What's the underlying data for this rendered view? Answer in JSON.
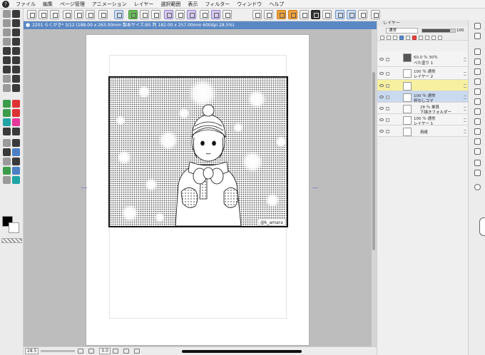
{
  "menu": {
    "app_icon_glyph": "?",
    "items": [
      "ファイル",
      "編集",
      "ページ管理",
      "アニメーション",
      "レイヤー",
      "選択範囲",
      "表示",
      "フィルター",
      "ウィンドウ",
      "ヘルプ"
    ]
  },
  "canvas_tab": {
    "title": "2201 らくがき* 3/12 (188.00 x 263.00mm 製本サイズ:B5 判 182.00 x 257.00mm 600dpi 28.5%)"
  },
  "artwork": {
    "signature": "@k_amara"
  },
  "status_bar": {
    "zoom": "28.5",
    "rotation": "0.0"
  },
  "layer_panel": {
    "title": "レイヤー",
    "blend_mode": "通常",
    "opacity": "100",
    "layers": [
      {
        "mode": "60.0 ％ 30％",
        "name": "べた塗り 1"
      },
      {
        "mode": "100 ％ 通常",
        "name": "レイヤー 2"
      },
      {
        "mode": "",
        "name": ""
      },
      {
        "mode": "100 ％ 通常",
        "name": "枠なしコマ"
      },
      {
        "mode": "28 ％ 乗算",
        "name": "下描きフォルダー"
      },
      {
        "mode": "100 ％ 通常",
        "name": "レイヤー 1"
      },
      {
        "mode": "",
        "name": "用紙"
      }
    ]
  },
  "colors": {
    "accent": "#5a88c4",
    "selected_layer": "#f6f0a0"
  }
}
